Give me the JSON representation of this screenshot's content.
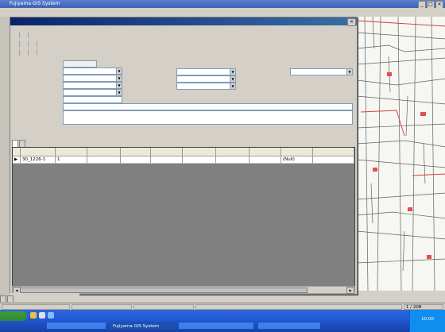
{
  "app": {
    "title": "Fujiyama GIS System",
    "menu": [
      "",
      "",
      "",
      "",
      ""
    ]
  },
  "dialog": {
    "title": "",
    "toolbar1": [
      "",
      "",
      ""
    ],
    "toolbar2": [
      "",
      "",
      "",
      ""
    ],
    "toolbar3": [
      "",
      "",
      "",
      ""
    ],
    "section_title": "",
    "fields": {
      "zaisan_bango_label": "",
      "zaisan_bango_value": "",
      "zaisan_kubun_label": "",
      "zaisan_kubun_value": "",
      "gen_label": "",
      "gen_value": "",
      "shozai_kubun_label": "",
      "shozai_kubun_value": "",
      "oaza_label": "",
      "oaza_value": "",
      "shozai_chiban_label": "",
      "shozai_chiban_value": "",
      "shisetsu_label": "",
      "shisetsu_value": "",
      "biko_label": "",
      "biko_value": "",
      "busho_label": "",
      "busho_value": "",
      "shisetsumei_label": "",
      "shisetsumei_value": "",
      "koaza_label": "",
      "koaza_value": "",
      "shoyusha_label": "",
      "shoyusha_value": ""
    },
    "tabs": [
      "",
      ""
    ],
    "grid": {
      "columns": [
        "",
        "",
        "",
        "",
        "",
        "",
        "",
        "",
        "",
        "",
        ""
      ],
      "rows": [
        [
          "▶",
          "30_1226-1",
          "1",
          "",
          "",
          "",
          "",
          "",
          "",
          "(Null)",
          ""
        ]
      ]
    }
  },
  "below": {
    "btn1": "",
    "btn2": "",
    "btn3": "",
    "btn4": ""
  },
  "statusbar": {
    "cells": [
      "",
      "",
      "",
      "1 / 208"
    ]
  },
  "taskbar": {
    "start_label": "",
    "tasks": [
      "",
      "Fujiyama GIS System",
      "",
      ""
    ],
    "tray_time": "10:00"
  },
  "colors": {
    "dialog_title": "#0a246a",
    "taskbar": "#245edb",
    "start": "#2f8a2f"
  }
}
